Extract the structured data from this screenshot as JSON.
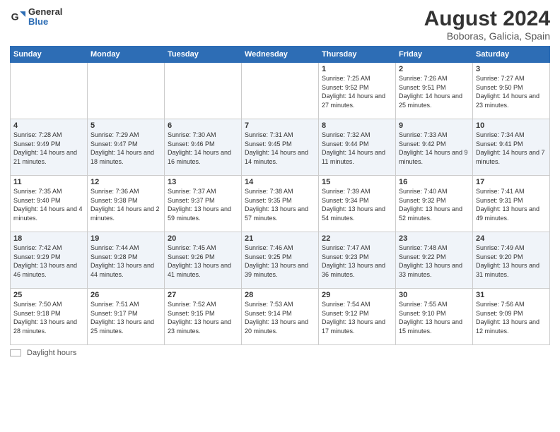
{
  "header": {
    "logo_general": "General",
    "logo_blue": "Blue",
    "main_title": "August 2024",
    "subtitle": "Boboras, Galicia, Spain"
  },
  "calendar": {
    "days_of_week": [
      "Sunday",
      "Monday",
      "Tuesday",
      "Wednesday",
      "Thursday",
      "Friday",
      "Saturday"
    ],
    "weeks": [
      [
        {
          "day": "",
          "info": ""
        },
        {
          "day": "",
          "info": ""
        },
        {
          "day": "",
          "info": ""
        },
        {
          "day": "",
          "info": ""
        },
        {
          "day": "1",
          "info": "Sunrise: 7:25 AM\nSunset: 9:52 PM\nDaylight: 14 hours and 27 minutes."
        },
        {
          "day": "2",
          "info": "Sunrise: 7:26 AM\nSunset: 9:51 PM\nDaylight: 14 hours and 25 minutes."
        },
        {
          "day": "3",
          "info": "Sunrise: 7:27 AM\nSunset: 9:50 PM\nDaylight: 14 hours and 23 minutes."
        }
      ],
      [
        {
          "day": "4",
          "info": "Sunrise: 7:28 AM\nSunset: 9:49 PM\nDaylight: 14 hours and 21 minutes."
        },
        {
          "day": "5",
          "info": "Sunrise: 7:29 AM\nSunset: 9:47 PM\nDaylight: 14 hours and 18 minutes."
        },
        {
          "day": "6",
          "info": "Sunrise: 7:30 AM\nSunset: 9:46 PM\nDaylight: 14 hours and 16 minutes."
        },
        {
          "day": "7",
          "info": "Sunrise: 7:31 AM\nSunset: 9:45 PM\nDaylight: 14 hours and 14 minutes."
        },
        {
          "day": "8",
          "info": "Sunrise: 7:32 AM\nSunset: 9:44 PM\nDaylight: 14 hours and 11 minutes."
        },
        {
          "day": "9",
          "info": "Sunrise: 7:33 AM\nSunset: 9:42 PM\nDaylight: 14 hours and 9 minutes."
        },
        {
          "day": "10",
          "info": "Sunrise: 7:34 AM\nSunset: 9:41 PM\nDaylight: 14 hours and 7 minutes."
        }
      ],
      [
        {
          "day": "11",
          "info": "Sunrise: 7:35 AM\nSunset: 9:40 PM\nDaylight: 14 hours and 4 minutes."
        },
        {
          "day": "12",
          "info": "Sunrise: 7:36 AM\nSunset: 9:38 PM\nDaylight: 14 hours and 2 minutes."
        },
        {
          "day": "13",
          "info": "Sunrise: 7:37 AM\nSunset: 9:37 PM\nDaylight: 13 hours and 59 minutes."
        },
        {
          "day": "14",
          "info": "Sunrise: 7:38 AM\nSunset: 9:35 PM\nDaylight: 13 hours and 57 minutes."
        },
        {
          "day": "15",
          "info": "Sunrise: 7:39 AM\nSunset: 9:34 PM\nDaylight: 13 hours and 54 minutes."
        },
        {
          "day": "16",
          "info": "Sunrise: 7:40 AM\nSunset: 9:32 PM\nDaylight: 13 hours and 52 minutes."
        },
        {
          "day": "17",
          "info": "Sunrise: 7:41 AM\nSunset: 9:31 PM\nDaylight: 13 hours and 49 minutes."
        }
      ],
      [
        {
          "day": "18",
          "info": "Sunrise: 7:42 AM\nSunset: 9:29 PM\nDaylight: 13 hours and 46 minutes."
        },
        {
          "day": "19",
          "info": "Sunrise: 7:44 AM\nSunset: 9:28 PM\nDaylight: 13 hours and 44 minutes."
        },
        {
          "day": "20",
          "info": "Sunrise: 7:45 AM\nSunset: 9:26 PM\nDaylight: 13 hours and 41 minutes."
        },
        {
          "day": "21",
          "info": "Sunrise: 7:46 AM\nSunset: 9:25 PM\nDaylight: 13 hours and 39 minutes."
        },
        {
          "day": "22",
          "info": "Sunrise: 7:47 AM\nSunset: 9:23 PM\nDaylight: 13 hours and 36 minutes."
        },
        {
          "day": "23",
          "info": "Sunrise: 7:48 AM\nSunset: 9:22 PM\nDaylight: 13 hours and 33 minutes."
        },
        {
          "day": "24",
          "info": "Sunrise: 7:49 AM\nSunset: 9:20 PM\nDaylight: 13 hours and 31 minutes."
        }
      ],
      [
        {
          "day": "25",
          "info": "Sunrise: 7:50 AM\nSunset: 9:18 PM\nDaylight: 13 hours and 28 minutes."
        },
        {
          "day": "26",
          "info": "Sunrise: 7:51 AM\nSunset: 9:17 PM\nDaylight: 13 hours and 25 minutes."
        },
        {
          "day": "27",
          "info": "Sunrise: 7:52 AM\nSunset: 9:15 PM\nDaylight: 13 hours and 23 minutes."
        },
        {
          "day": "28",
          "info": "Sunrise: 7:53 AM\nSunset: 9:14 PM\nDaylight: 13 hours and 20 minutes."
        },
        {
          "day": "29",
          "info": "Sunrise: 7:54 AM\nSunset: 9:12 PM\nDaylight: 13 hours and 17 minutes."
        },
        {
          "day": "30",
          "info": "Sunrise: 7:55 AM\nSunset: 9:10 PM\nDaylight: 13 hours and 15 minutes."
        },
        {
          "day": "31",
          "info": "Sunrise: 7:56 AM\nSunset: 9:09 PM\nDaylight: 13 hours and 12 minutes."
        }
      ]
    ]
  },
  "footer": {
    "daylight_label": "Daylight hours"
  }
}
